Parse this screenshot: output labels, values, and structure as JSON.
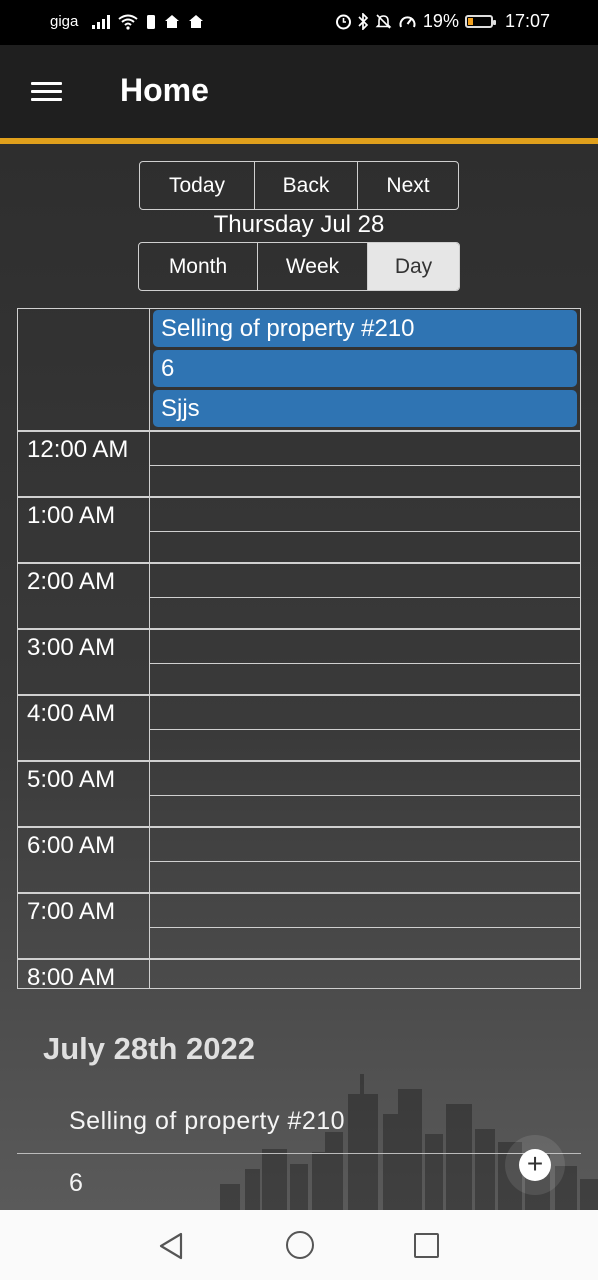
{
  "status_bar": {
    "carrier": "giga",
    "battery_percent": "19%",
    "time": "17:07",
    "icons": [
      "signal-icon",
      "wifi-icon",
      "sim-icon",
      "home-icon",
      "home-icon",
      "alarm-icon",
      "bluetooth-icon",
      "mute-icon",
      "speed-icon"
    ]
  },
  "app_bar": {
    "title": "Home"
  },
  "nav_buttons": {
    "today": "Today",
    "back": "Back",
    "next": "Next"
  },
  "current_date": "Thursday Jul 28",
  "view_buttons": {
    "month": "Month",
    "week": "Week",
    "day": "Day",
    "active": "Day"
  },
  "all_day_events": [
    "Selling of property #210",
    "6",
    "Sjjs"
  ],
  "time_slots": [
    "12:00 AM",
    "1:00 AM",
    "2:00 AM",
    "3:00 AM",
    "4:00 AM",
    "5:00 AM",
    "6:00 AM",
    "7:00 AM",
    "8:00 AM"
  ],
  "agenda": {
    "date": "July 28th 2022",
    "items": [
      "Selling of property #210",
      "6"
    ]
  },
  "fab": {
    "label": "+"
  },
  "colors": {
    "accent": "#e0a01c",
    "event": "#2f74b3",
    "appbar": "#1f1f1f"
  }
}
